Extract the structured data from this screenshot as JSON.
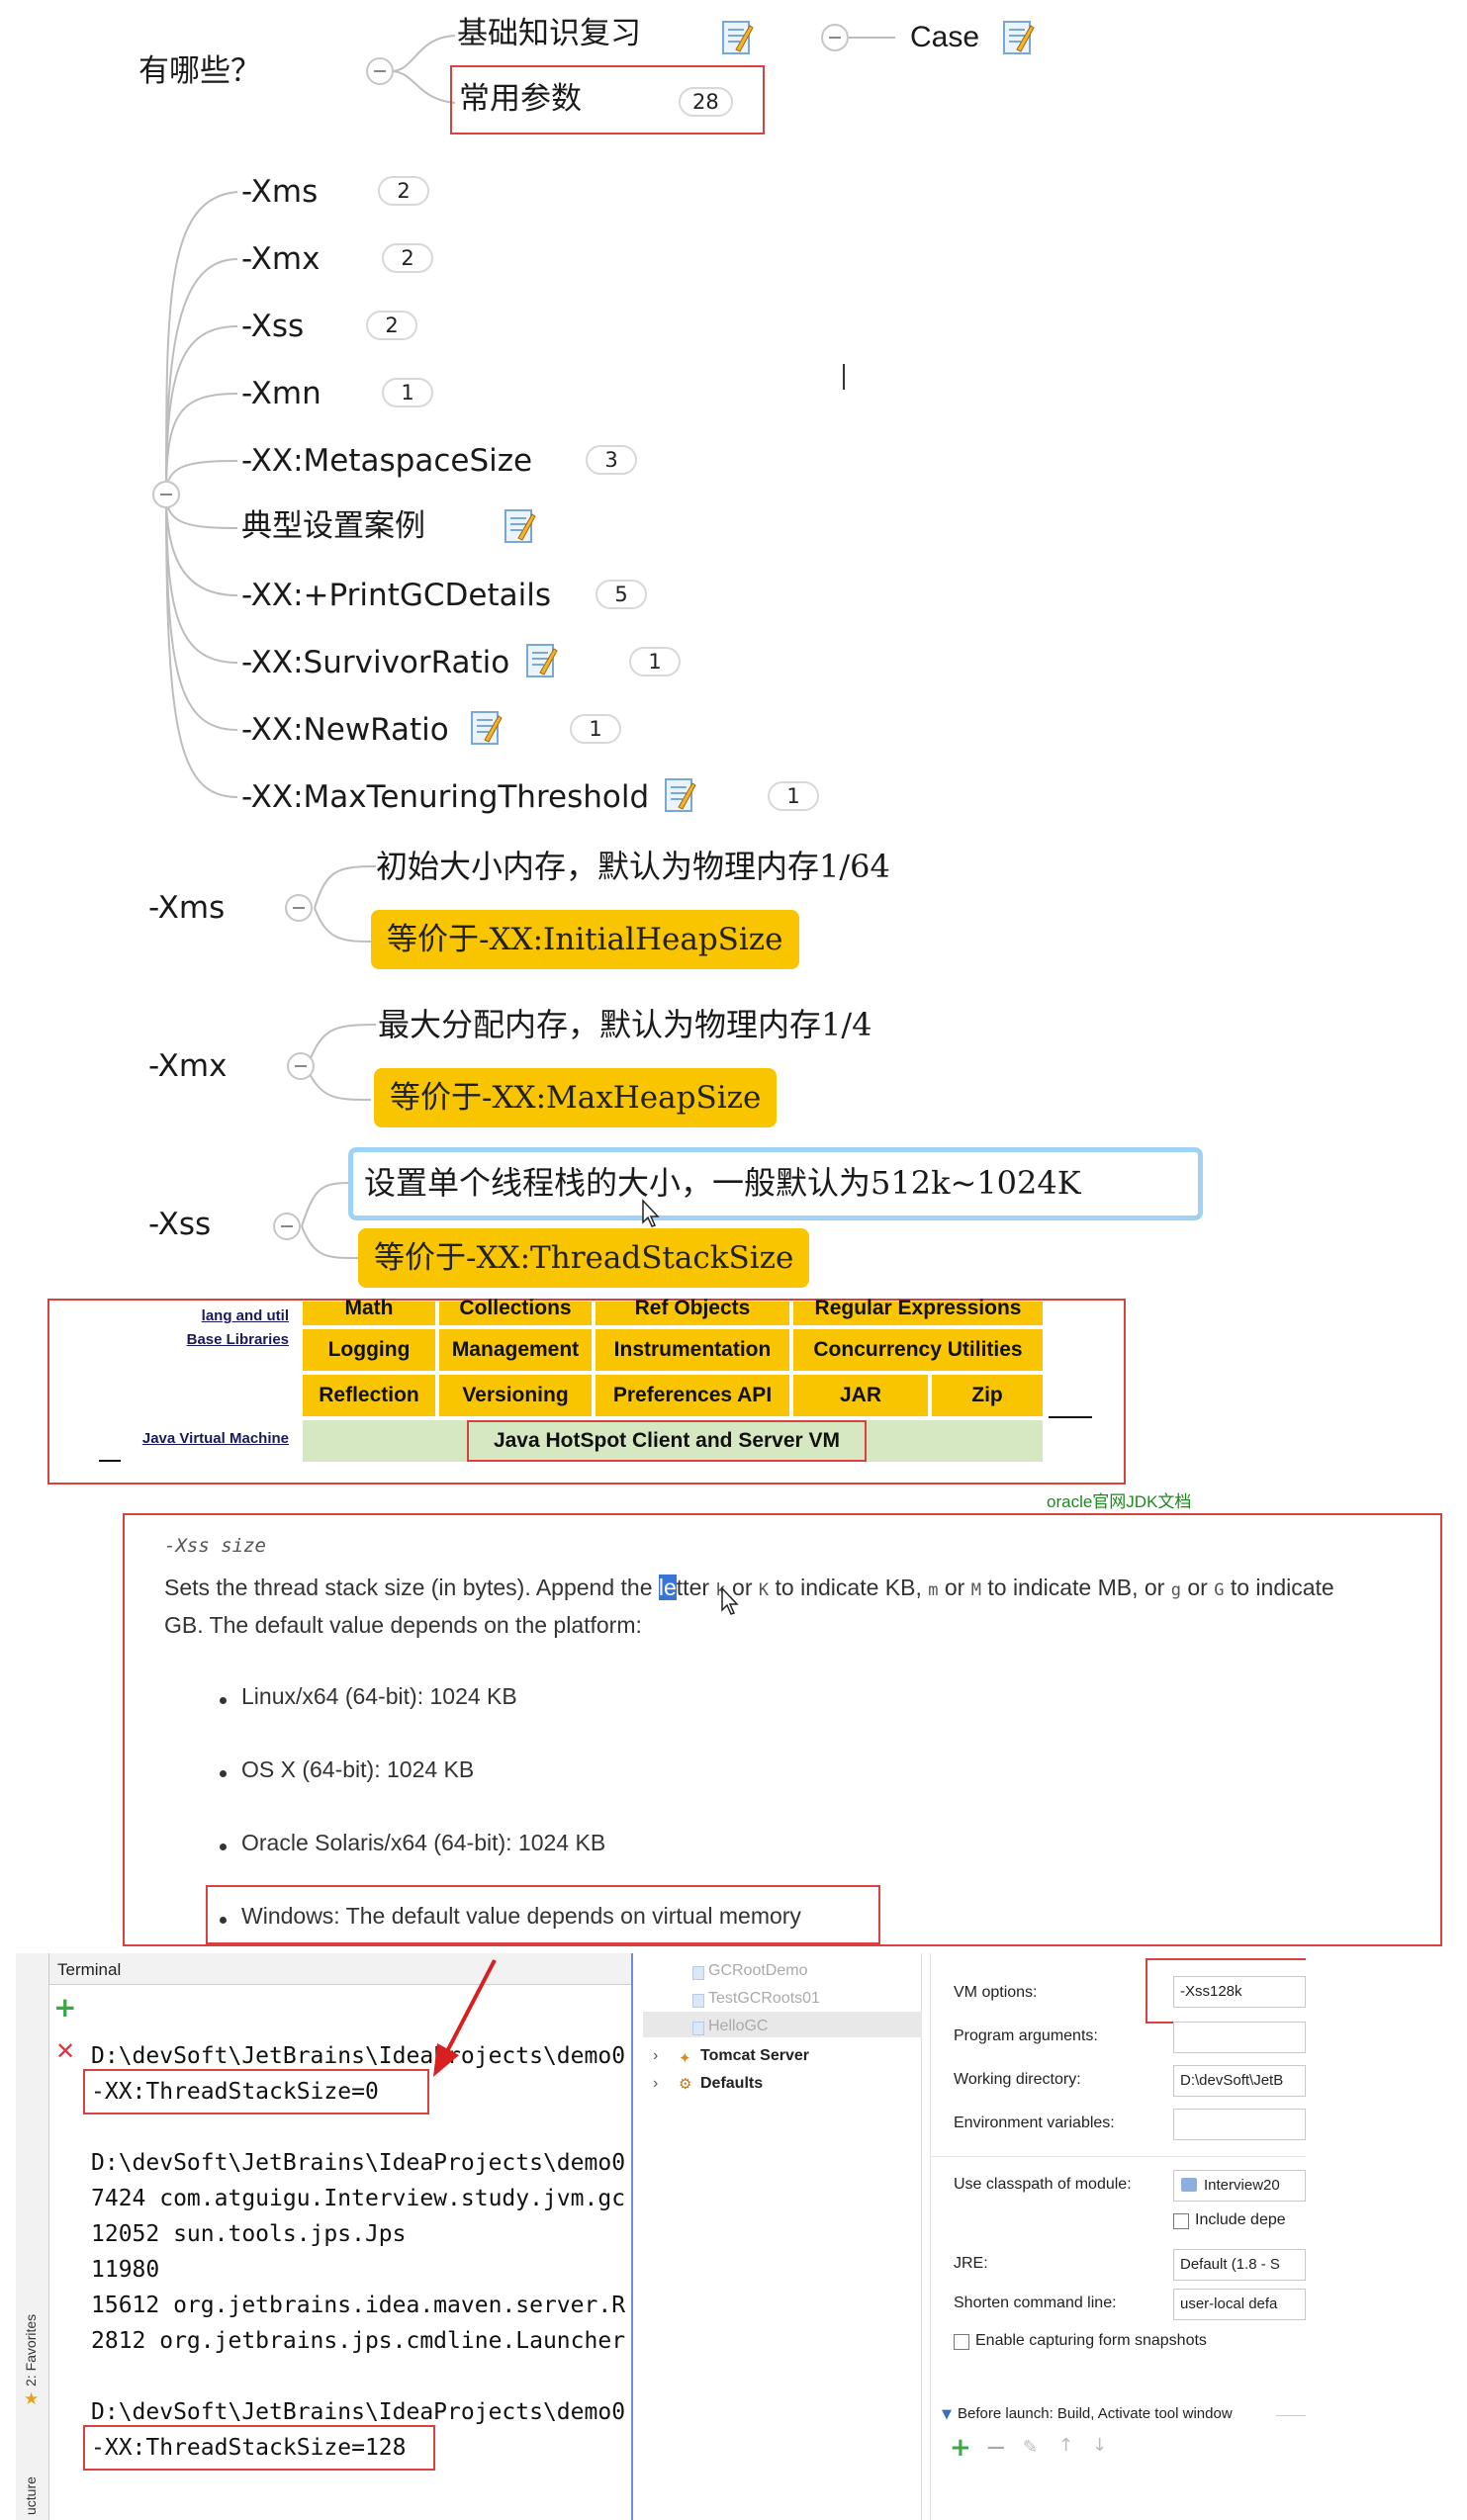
{
  "top_map": {
    "root": "有哪些？",
    "branch_basics": "基础知识复习",
    "branch_case": "Case",
    "branch_params": "常用参数",
    "branch_params_count": "28"
  },
  "param_list": [
    {
      "label": "-Xms",
      "count": "2",
      "note": false
    },
    {
      "label": "-Xmx",
      "count": "2",
      "note": false
    },
    {
      "label": "-Xss",
      "count": "2",
      "note": false
    },
    {
      "label": "-Xmn",
      "count": "1",
      "note": false
    },
    {
      "label": "-XX:MetaspaceSize",
      "count": "3",
      "note": false
    },
    {
      "label": "典型设置案例",
      "count": "",
      "note": true
    },
    {
      "label": "-XX:+PrintGCDetails",
      "count": "5",
      "note": false
    },
    {
      "label": "-XX:SurvivorRatio",
      "count": "1",
      "note": true
    },
    {
      "label": "-XX:NewRatio",
      "count": "1",
      "note": true
    },
    {
      "label": "-XX:MaxTenuringThreshold",
      "count": "1",
      "note": true
    }
  ],
  "details": {
    "xms": {
      "label": "-Xms",
      "desc": "初始大小内存，默认为物理内存1/64",
      "equiv": "等价于-XX:InitialHeapSize"
    },
    "xmx": {
      "label": "-Xmx",
      "desc": "最大分配内存，默认为物理内存1/4",
      "equiv": "等价于-XX:MaxHeapSize"
    },
    "xss": {
      "label": "-Xss",
      "desc": "设置单个线程栈的大小，一般默认为512k~1024K",
      "equiv": "等价于-XX:ThreadStackSize"
    }
  },
  "jdk_table": {
    "row_labels": {
      "lang_util": "lang and util",
      "base": "Base Libraries",
      "jvm": "Java Virtual Machine"
    },
    "row0": [
      "Math",
      "Collections",
      "Ref Objects",
      "Regular Expressions"
    ],
    "row1": [
      "Logging",
      "Management",
      "Instrumentation",
      "Concurrency Utilities"
    ],
    "row2": [
      "Reflection",
      "Versioning",
      "Preferences API",
      "JAR",
      "Zip"
    ],
    "jvm_cell": "Java HotSpot Client and Server VM",
    "source_caption": "oracle官网JDK文档"
  },
  "doc": {
    "heading": "-Xss size",
    "p1_a": "Sets the thread stack size (in bytes). Append the ",
    "p1_hl": "le",
    "p1_b": "tter ",
    "k1": "k",
    "or1": " or ",
    "K1": "K",
    "p1_c": " to indicate KB, ",
    "m1": "m",
    "or2": " or ",
    "M1": "M",
    "p1_d": " to indicate MB, or ",
    "g1": "g",
    "or3": " or ",
    "G1": "G",
    "p1_e": " to indicate",
    "p1_line2": "GB. The default value depends on the platform:",
    "bullets": [
      "Linux/x64 (64-bit): 1024 KB",
      "OS X (64-bit): 1024 KB",
      "Oracle Solaris/x64 (64-bit): 1024 KB",
      "Windows: The default value depends on virtual memory"
    ]
  },
  "terminal": {
    "tab": "Terminal",
    "side_favorites": "2: Favorites",
    "side_structure": "ucture",
    "lines": [
      "D:\\devSoft\\JetBrains\\IdeaProjects\\demo0",
      "-XX:ThreadStackSize=0",
      "",
      "D:\\devSoft\\JetBrains\\IdeaProjects\\demo0",
      "7424 com.atguigu.Interview.study.jvm.gc",
      "12052 sun.tools.jps.Jps",
      "11980",
      "15612 org.jetbrains.idea.maven.server.R",
      "2812 org.jetbrains.jps.cmdline.Launcher",
      "",
      "D:\\devSoft\\JetBrains\\IdeaProjects\\demo0",
      "-XX:ThreadStackSize=128"
    ]
  },
  "run_config": {
    "tree": [
      "GCRootDemo",
      "TestGCRoots01",
      "HelloGC"
    ],
    "tomcat": "Tomcat Server",
    "defaults": "Defaults",
    "vm_options_label": "VM options:",
    "vm_options_value": "-Xss128k",
    "program_args_label": "Program arguments:",
    "workdir_label": "Working directory:",
    "workdir_value": "D:\\devSoft\\JetB",
    "env_label": "Environment variables:",
    "classpath_label": "Use classpath of module:",
    "classpath_value": "Interview20",
    "include_deps": "Include depe",
    "jre_label": "JRE:",
    "jre_value": "Default (1.8 - S",
    "shorten_label": "Shorten command line:",
    "shorten_value": "user-local defa",
    "snapshots": "Enable capturing form snapshots",
    "before_launch": "Before launch: Build, Activate tool window"
  },
  "colors": {
    "accent_yellow": "#f8c500",
    "red_box": "#d94040",
    "blue_box": "#9fd3f5",
    "jvm_green": "#d6e8c2"
  }
}
